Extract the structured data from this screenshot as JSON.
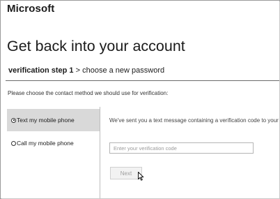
{
  "brand": {
    "name": "Microsoft"
  },
  "page": {
    "title": "Get back into your account"
  },
  "breadcrumb": {
    "current": "verification step 1",
    "separator": ">",
    "next": "choose a new password"
  },
  "instruction": "Please choose the contact method we should use for verification:",
  "options": [
    {
      "label": "Text my mobile phone",
      "selected": true
    },
    {
      "label": "Call my mobile phone",
      "selected": false
    }
  ],
  "detail": {
    "message": "We've sent you a text message containing a verification code to your p",
    "code_placeholder": "Enter your verification code",
    "code_value": ""
  },
  "actions": {
    "next_label": "Next",
    "next_enabled": false
  },
  "theme": {
    "selected_bg": "#d9d9d9",
    "rule_color": "#6b6b6b"
  }
}
